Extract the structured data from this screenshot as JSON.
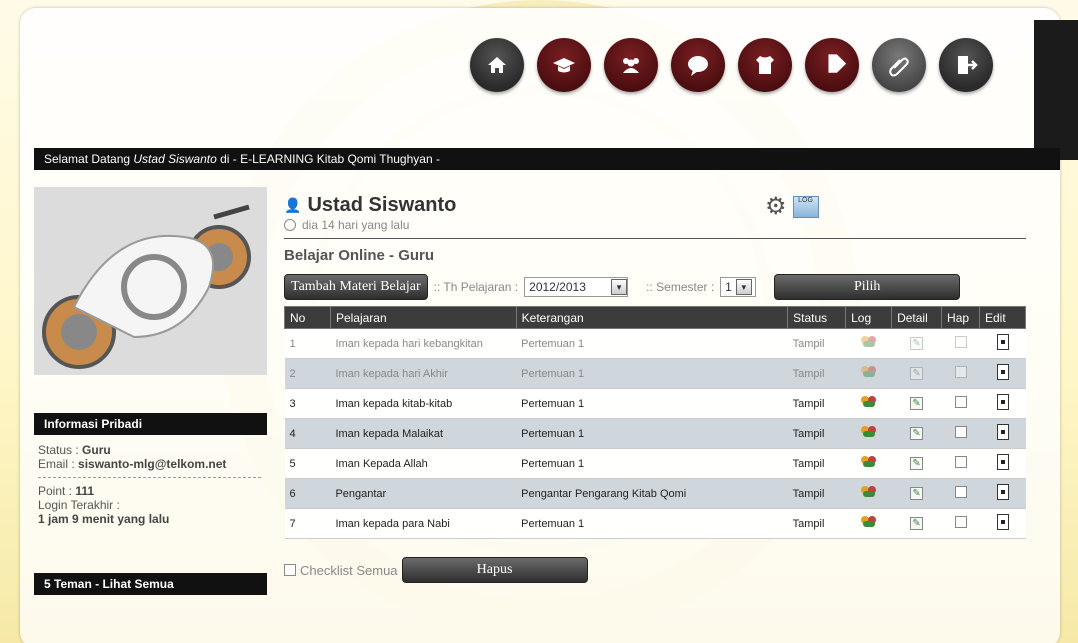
{
  "welcome": {
    "prefix": "Selamat Datang ",
    "name": "Ustad Siswanto",
    "suffix": " di - E-LEARNING Kitab Qomi Thughyan -"
  },
  "nav": [
    "home-icon",
    "graduation-icon",
    "users-icon",
    "chat-icon",
    "shirt-icon",
    "tag-icon",
    "paperclip-icon",
    "logout-icon"
  ],
  "user": {
    "name": "Ustad Siswanto",
    "ago": "dia 14 hari yang lalu"
  },
  "section_title": "Belajar Online - Guru",
  "toolbar": {
    "add_label": "Tambah Materi Belajar",
    "year_label": ":: Th Pelajaran :",
    "year_value": "2012/2013",
    "semester_label": ":: Semester :",
    "semester_value": "1",
    "pilih_label": "Pilih"
  },
  "table": {
    "headers": [
      "No",
      "Pelajaran",
      "Keterangan",
      "Status",
      "Log",
      "Detail",
      "Hap",
      "Edit"
    ],
    "rows": [
      {
        "no": "1",
        "pelajaran": "Iman kepada hari kebangkitan",
        "keterangan": "Pertemuan 1",
        "status": "Tampil"
      },
      {
        "no": "2",
        "pelajaran": "Iman kepada hari Akhir",
        "keterangan": "Pertemuan 1",
        "status": "Tampil"
      },
      {
        "no": "3",
        "pelajaran": "Iman kepada kitab-kitab",
        "keterangan": "Pertemuan 1",
        "status": "Tampil"
      },
      {
        "no": "4",
        "pelajaran": "Iman kepada Malaikat",
        "keterangan": "Pertemuan 1",
        "status": "Tampil"
      },
      {
        "no": "5",
        "pelajaran": "Iman Kepada Allah",
        "keterangan": "Pertemuan 1",
        "status": "Tampil"
      },
      {
        "no": "6",
        "pelajaran": "Pengantar",
        "keterangan": "Pengantar Pengarang Kitab Qomi",
        "status": "Tampil"
      },
      {
        "no": "7",
        "pelajaran": "Iman kepada para Nabi",
        "keterangan": "Pertemuan 1",
        "status": "Tampil"
      }
    ]
  },
  "checklist_label": "Checklist Semua",
  "hapus_label": "Hapus",
  "info": {
    "title": "Informasi Pribadi",
    "status_label": "Status : ",
    "status_value": "Guru",
    "email_label": "Email : ",
    "email_value": "siswanto-mlg@telkom.net",
    "point_label": "Point : ",
    "point_value": "111",
    "login_label": "Login Terakhir :",
    "login_value": "1 jam 9 menit yang lalu"
  },
  "friends": "5 Teman - Lihat Semua"
}
